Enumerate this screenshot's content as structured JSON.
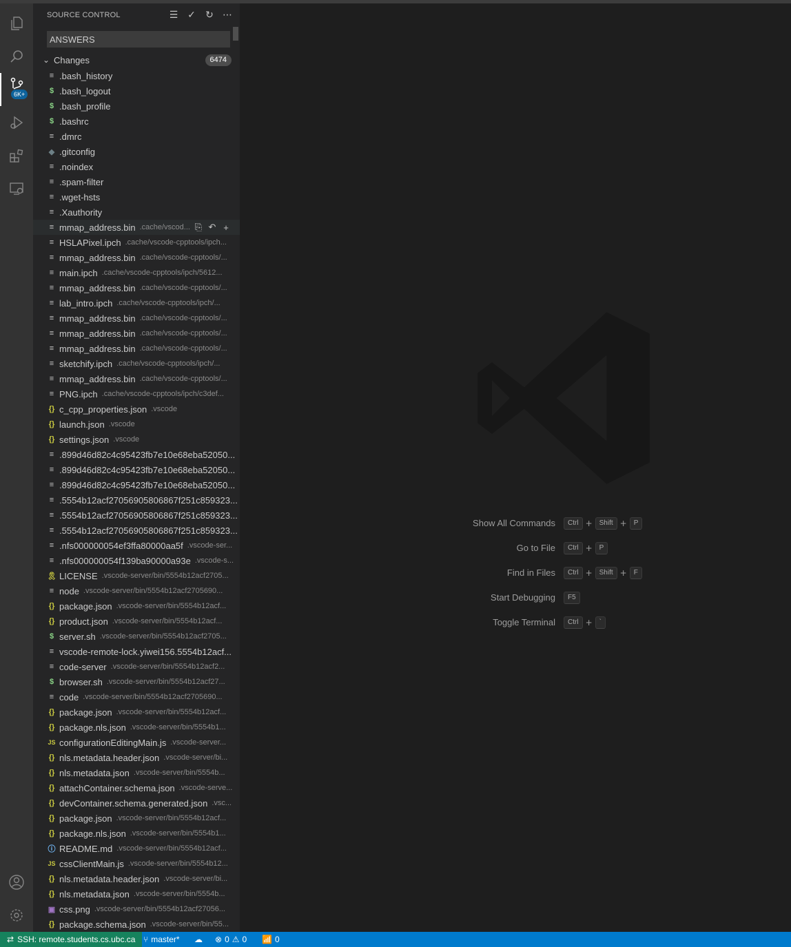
{
  "sidebar": {
    "title": "SOURCE CONTROL",
    "commit_message": "ANSWERS",
    "changes_label": "Changes",
    "changes_count": "6474",
    "scm_badge": "6K+",
    "files": [
      {
        "name": ".bash_history",
        "path": "",
        "icon": "text"
      },
      {
        "name": ".bash_logout",
        "path": "",
        "icon": "sh"
      },
      {
        "name": ".bash_profile",
        "path": "",
        "icon": "sh"
      },
      {
        "name": ".bashrc",
        "path": "",
        "icon": "sh"
      },
      {
        "name": ".dmrc",
        "path": "",
        "icon": "text"
      },
      {
        "name": ".gitconfig",
        "path": "",
        "icon": "git"
      },
      {
        "name": ".noindex",
        "path": "",
        "icon": "text"
      },
      {
        "name": ".spam-filter",
        "path": "",
        "icon": "text"
      },
      {
        "name": ".wget-hsts",
        "path": "",
        "icon": "text"
      },
      {
        "name": ".Xauthority",
        "path": "",
        "icon": "text"
      },
      {
        "name": "mmap_address.bin",
        "path": ".cache/vscod...",
        "icon": "text",
        "hover": true
      },
      {
        "name": "HSLAPixel.ipch",
        "path": ".cache/vscode-cpptools/ipch...",
        "icon": "text"
      },
      {
        "name": "mmap_address.bin",
        "path": ".cache/vscode-cpptools/...",
        "icon": "text"
      },
      {
        "name": "main.ipch",
        "path": ".cache/vscode-cpptools/ipch/5612...",
        "icon": "text"
      },
      {
        "name": "mmap_address.bin",
        "path": ".cache/vscode-cpptools/...",
        "icon": "text"
      },
      {
        "name": "lab_intro.ipch",
        "path": ".cache/vscode-cpptools/ipch/...",
        "icon": "text"
      },
      {
        "name": "mmap_address.bin",
        "path": ".cache/vscode-cpptools/...",
        "icon": "text"
      },
      {
        "name": "mmap_address.bin",
        "path": ".cache/vscode-cpptools/...",
        "icon": "text"
      },
      {
        "name": "mmap_address.bin",
        "path": ".cache/vscode-cpptools/...",
        "icon": "text"
      },
      {
        "name": "sketchify.ipch",
        "path": ".cache/vscode-cpptools/ipch/...",
        "icon": "text"
      },
      {
        "name": "mmap_address.bin",
        "path": ".cache/vscode-cpptools/...",
        "icon": "text"
      },
      {
        "name": "PNG.ipch",
        "path": ".cache/vscode-cpptools/ipch/c3def...",
        "icon": "text"
      },
      {
        "name": "c_cpp_properties.json",
        "path": ".vscode",
        "icon": "json"
      },
      {
        "name": "launch.json",
        "path": ".vscode",
        "icon": "json"
      },
      {
        "name": "settings.json",
        "path": ".vscode",
        "icon": "json"
      },
      {
        "name": ".899d46d82c4c95423fb7e10e68eba52050...",
        "path": "",
        "icon": "text"
      },
      {
        "name": ".899d46d82c4c95423fb7e10e68eba52050...",
        "path": "",
        "icon": "text"
      },
      {
        "name": ".899d46d82c4c95423fb7e10e68eba52050...",
        "path": "",
        "icon": "text"
      },
      {
        "name": ".5554b12acf27056905806867f251c859323...",
        "path": "",
        "icon": "text"
      },
      {
        "name": ".5554b12acf27056905806867f251c859323...",
        "path": "",
        "icon": "text"
      },
      {
        "name": ".5554b12acf27056905806867f251c859323...",
        "path": "",
        "icon": "text"
      },
      {
        "name": ".nfs000000054ef3ffa80000aa5f",
        "path": ".vscode-ser...",
        "icon": "text"
      },
      {
        "name": ".nfs000000054f139ba90000a93e",
        "path": ".vscode-s...",
        "icon": "text"
      },
      {
        "name": "LICENSE",
        "path": ".vscode-server/bin/5554b12acf2705...",
        "icon": "lic"
      },
      {
        "name": "node",
        "path": ".vscode-server/bin/5554b12acf2705690...",
        "icon": "text"
      },
      {
        "name": "package.json",
        "path": ".vscode-server/bin/5554b12acf...",
        "icon": "json"
      },
      {
        "name": "product.json",
        "path": ".vscode-server/bin/5554b12acf...",
        "icon": "json"
      },
      {
        "name": "server.sh",
        "path": ".vscode-server/bin/5554b12acf2705...",
        "icon": "sh"
      },
      {
        "name": "vscode-remote-lock.yiwei156.5554b12acf...",
        "path": "",
        "icon": "text"
      },
      {
        "name": "code-server",
        "path": ".vscode-server/bin/5554b12acf2...",
        "icon": "text"
      },
      {
        "name": "browser.sh",
        "path": ".vscode-server/bin/5554b12acf27...",
        "icon": "sh"
      },
      {
        "name": "code",
        "path": ".vscode-server/bin/5554b12acf2705690...",
        "icon": "text"
      },
      {
        "name": "package.json",
        "path": ".vscode-server/bin/5554b12acf...",
        "icon": "json"
      },
      {
        "name": "package.nls.json",
        "path": ".vscode-server/bin/5554b1...",
        "icon": "json"
      },
      {
        "name": "configurationEditingMain.js",
        "path": ".vscode-server...",
        "icon": "js"
      },
      {
        "name": "nls.metadata.header.json",
        "path": ".vscode-server/bi...",
        "icon": "json"
      },
      {
        "name": "nls.metadata.json",
        "path": ".vscode-server/bin/5554b...",
        "icon": "json"
      },
      {
        "name": "attachContainer.schema.json",
        "path": ".vscode-serve...",
        "icon": "json"
      },
      {
        "name": "devContainer.schema.generated.json",
        "path": ".vsc...",
        "icon": "json"
      },
      {
        "name": "package.json",
        "path": ".vscode-server/bin/5554b12acf...",
        "icon": "json"
      },
      {
        "name": "package.nls.json",
        "path": ".vscode-server/bin/5554b1...",
        "icon": "json"
      },
      {
        "name": "README.md",
        "path": ".vscode-server/bin/5554b12acf...",
        "icon": "info"
      },
      {
        "name": "cssClientMain.js",
        "path": ".vscode-server/bin/5554b12...",
        "icon": "js"
      },
      {
        "name": "nls.metadata.header.json",
        "path": ".vscode-server/bi...",
        "icon": "json"
      },
      {
        "name": "nls.metadata.json",
        "path": ".vscode-server/bin/5554b...",
        "icon": "json"
      },
      {
        "name": "css.png",
        "path": ".vscode-server/bin/5554b12acf27056...",
        "icon": "img"
      },
      {
        "name": "package.schema.json",
        "path": ".vscode-server/bin/55...",
        "icon": "json"
      }
    ]
  },
  "icons": {
    "text": "≡",
    "sh": "$",
    "json": "{}",
    "js": "JS",
    "git": "◆",
    "lic": "🎗",
    "info": "ⓘ",
    "img": "▣"
  },
  "shortcuts": [
    {
      "label": "Show All Commands",
      "keys": [
        "Ctrl",
        "Shift",
        "P"
      ]
    },
    {
      "label": "Go to File",
      "keys": [
        "Ctrl",
        "P"
      ]
    },
    {
      "label": "Find in Files",
      "keys": [
        "Ctrl",
        "Shift",
        "F"
      ]
    },
    {
      "label": "Start Debugging",
      "keys": [
        "F5"
      ]
    },
    {
      "label": "Toggle Terminal",
      "keys": [
        "Ctrl",
        "`"
      ]
    }
  ],
  "statusbar": {
    "remote": "SSH: remote.students.cs.ubc.ca",
    "branch": "master*",
    "errors": "0",
    "warnings": "0",
    "ports": "0"
  },
  "colors": {
    "accent": "#007acc",
    "remote": "#16825d",
    "sidebar_bg": "#252526",
    "editor_bg": "#1e1e1e"
  }
}
